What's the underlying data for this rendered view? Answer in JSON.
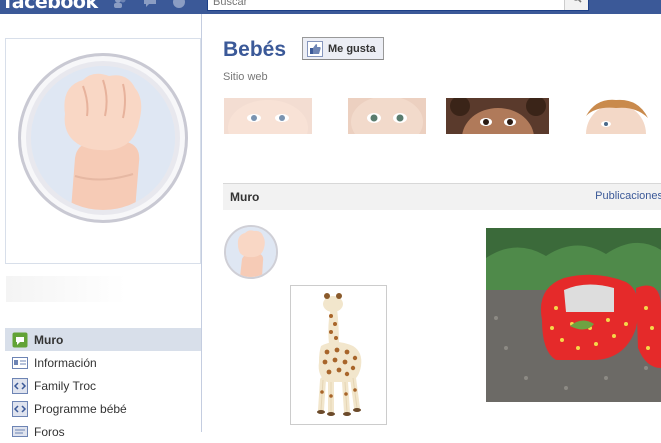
{
  "topbar": {
    "logo": "facebook",
    "search_placeholder": "Buscar",
    "icons": [
      "friend-requests-icon",
      "messages-icon",
      "notifications-icon",
      "search-icon"
    ]
  },
  "page": {
    "title": "Bebés",
    "like_label": "Me gusta",
    "category": "Sitio web"
  },
  "nav": {
    "items": [
      {
        "label": "Muro",
        "icon": "wall-icon",
        "active": true
      },
      {
        "label": "Información",
        "icon": "info-icon",
        "active": false
      },
      {
        "label": "Family Troc",
        "icon": "fbml-app-icon",
        "active": false
      },
      {
        "label": "Programme bébé",
        "icon": "fbml-app-icon",
        "active": false
      },
      {
        "label": "Foros",
        "icon": "forum-icon",
        "active": false
      }
    ]
  },
  "wall": {
    "tab_label": "Muro",
    "publications_label": "Publicaciones"
  },
  "colors": {
    "brand_blue": "#3b5998",
    "nav_active": "#d8dfea",
    "wall_bar": "#f2f2f2"
  }
}
